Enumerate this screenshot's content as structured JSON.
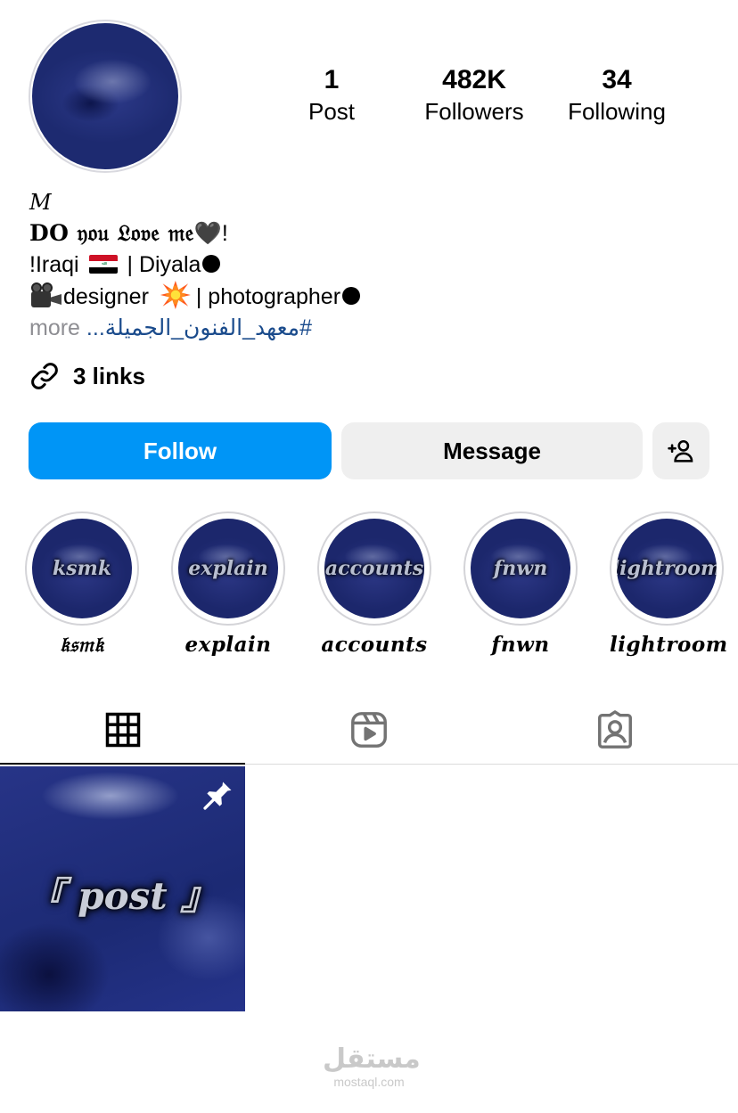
{
  "profile": {
    "stats": [
      {
        "count": "1",
        "label": "Post"
      },
      {
        "count": "482K",
        "label": "Followers"
      },
      {
        "count": "34",
        "label": "Following"
      }
    ],
    "bio": {
      "name": "M",
      "line1_text": "DO 𝔶𝔬𝔲 𝔏𝔬𝔳𝔢 𝔪𝔢",
      "line1_emoji": "🖤",
      "line1_end": "!",
      "line2_start": "!Iraqi",
      "line2_mid": "| Diyala",
      "line3_a": "designer",
      "line3_b": "| photographer",
      "more": "more",
      "hashtag": "#معهد_الفنون_الجميلة..."
    },
    "links_label": "3 links"
  },
  "actions": {
    "follow_label": "Follow",
    "message_label": "Message"
  },
  "highlights": [
    {
      "label": "𝔨𝔰𝔪𝔨",
      "cover_text": "ksmk"
    },
    {
      "label": "explain",
      "cover_text": "explain"
    },
    {
      "label": "accounts",
      "cover_text": "accounts"
    },
    {
      "label": "fnwn",
      "cover_text": "fnwn"
    },
    {
      "label": "lightroom",
      "cover_text": "lightroom"
    }
  ],
  "tabs": [
    {
      "icon": "grid-icon",
      "active": true
    },
    {
      "icon": "reels-icon",
      "active": false
    },
    {
      "icon": "tagged-icon",
      "active": false
    }
  ],
  "posts": [
    {
      "cover_text": "『 post 』",
      "pinned": true
    }
  ],
  "watermark": {
    "arabic": "مستقل",
    "latin": "mostaql.com"
  },
  "colors": {
    "primary": "#0095f6",
    "secondary_button": "#efefef",
    "hashtag": "#1a4b8c",
    "muted": "#8e8e93"
  }
}
